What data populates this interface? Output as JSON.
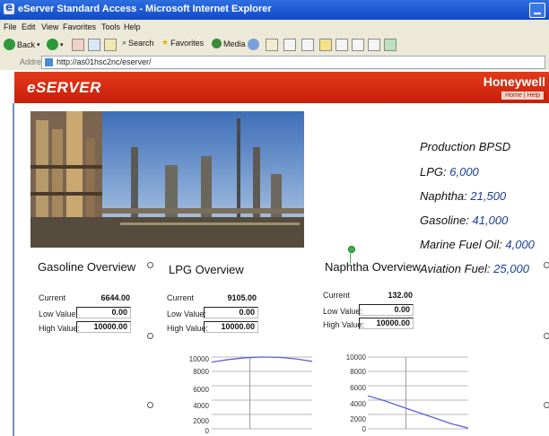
{
  "window": {
    "title": "eServer Standard Access - Microsoft Internet Explorer",
    "menu": [
      "File",
      "Edit",
      "View",
      "Favorites",
      "Tools",
      "Help"
    ],
    "toolbar": {
      "back": "Back",
      "search": "Search",
      "favorites": "Favorites",
      "media": "Media"
    },
    "address_label": "Address",
    "address_url": "http://as01hsc2nc/eserver/"
  },
  "header": {
    "brand": "eSERVER",
    "company": "Honeywell",
    "links": [
      "Home",
      "Help"
    ],
    "link_separator": "|",
    "color": "#d42a12"
  },
  "production": {
    "title": "Production BPSD",
    "items": [
      {
        "label": "LPG:",
        "value": "6,000"
      },
      {
        "label": "Naphtha:",
        "value": "21,500"
      },
      {
        "label": "Gasoline:",
        "value": "41,000"
      },
      {
        "label": "Marine Fuel Oil:",
        "value": "4,000"
      },
      {
        "label": "Aviation Fuel:",
        "value": "25,000"
      }
    ]
  },
  "panels": [
    {
      "title": "Gasoline Overview",
      "current_label": "Current",
      "current": "6644.00",
      "low_label": "Low Value:",
      "low": "0.00",
      "high_label": "High Value:",
      "high": "10000.00"
    },
    {
      "title": "LPG Overview",
      "current_label": "Current",
      "current": "9105.00",
      "low_label": "Low Value:",
      "low": "0.00",
      "high_label": "High Value:",
      "high": "10000.00",
      "chart_ticks": [
        "10000",
        "8000",
        "6000",
        "4000",
        "2000",
        "0"
      ]
    },
    {
      "title": "Naphtha Overview",
      "current_label": "Current",
      "current": "132.00",
      "low_label": "Low Value:",
      "low": "0.00",
      "high_label": "High Value:",
      "high": "10000.00",
      "chart_ticks": [
        "10000",
        "8000",
        "6000",
        "4000",
        "2000",
        "0"
      ]
    }
  ],
  "chart_data": [
    {
      "type": "line",
      "ylim": [
        0,
        10000
      ],
      "y_ticks": [
        10000,
        8000,
        6000,
        4000,
        2000,
        0
      ],
      "series": [
        {
          "values": [
            9300,
            9650,
            9900,
            10000,
            9950,
            9750,
            9400
          ]
        }
      ]
    },
    {
      "type": "line",
      "ylim": [
        0,
        10000
      ],
      "y_ticks": [
        10000,
        8000,
        6000,
        4000,
        2000,
        0
      ],
      "series": [
        {
          "values": [
            4600,
            3900,
            3100,
            2300,
            1500,
            700,
            100
          ]
        }
      ]
    }
  ],
  "colors": {
    "line": "#5b62d8",
    "value_text": "#1a3f9a"
  }
}
